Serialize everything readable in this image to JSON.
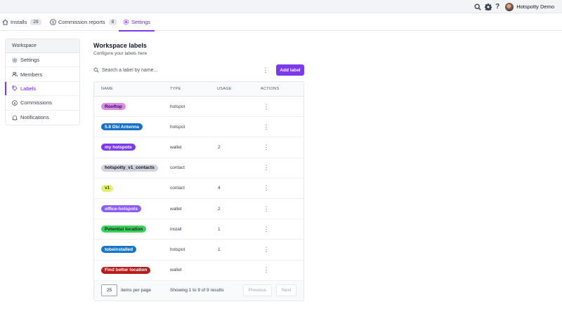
{
  "topbar": {
    "user_name": "Hotspotty Demo",
    "icons": [
      "search-icon",
      "gear-icon",
      "help-icon",
      "avatar"
    ],
    "help_glyph": "?"
  },
  "tabs": [
    {
      "label": "Installs",
      "count": "29",
      "icon": "home-icon"
    },
    {
      "label": "Commission reports",
      "count": "8",
      "icon": "dollar-circle-icon"
    },
    {
      "label": "Settings",
      "icon": "gear-icon",
      "active": true
    }
  ],
  "sidebar": {
    "heading": "Workspace",
    "items": [
      {
        "label": "Settings",
        "icon": "gear-icon"
      },
      {
        "label": "Members",
        "icon": "users-icon"
      },
      {
        "label": "Labels",
        "icon": "tag-icon",
        "active": true
      },
      {
        "label": "Commissions",
        "icon": "dollar-circle-icon"
      },
      {
        "label": "Notifications",
        "icon": "bell-icon"
      }
    ]
  },
  "main": {
    "title": "Workspace labels",
    "subtitle": "Configure your labels here",
    "search_placeholder": "Search a label by name...",
    "add_button": "Add label",
    "more_glyph": "⋮"
  },
  "table": {
    "columns": [
      "NAME",
      "TYPE",
      "USAGE",
      "ACTIONS"
    ],
    "rows": [
      {
        "name": "Rooftop",
        "type": "hotspot",
        "usage": "",
        "bg": "#d98ce0",
        "fg": "#3b0764"
      },
      {
        "name": "5.8 Dbi Antenna",
        "type": "hotspot",
        "usage": "",
        "bg": "#1d6fc4",
        "fg": "#ffffff"
      },
      {
        "name": "my hotspots",
        "type": "wallet",
        "usage": "2",
        "bg": "#7c3aed",
        "fg": "#ffffff"
      },
      {
        "name": "hotspotty_v1_contacts",
        "type": "contact",
        "usage": "",
        "bg": "#d1d5db",
        "fg": "#111827"
      },
      {
        "name": "v1",
        "type": "contact",
        "usage": "4",
        "bg": "#e7ef73",
        "fg": "#3f3f00"
      },
      {
        "name": "office-hotspots",
        "type": "wallet",
        "usage": "2",
        "bg": "#8b5cf6",
        "fg": "#ffffff"
      },
      {
        "name": "Potential location",
        "type": "install",
        "usage": "1",
        "bg": "#3ccf5a",
        "fg": "#052e16"
      },
      {
        "name": "tobeinstalled",
        "type": "hotspot",
        "usage": "1",
        "bg": "#1677c9",
        "fg": "#ffffff"
      },
      {
        "name": "Find better location",
        "type": "wallet",
        "usage": "",
        "bg": "#b91c1c",
        "fg": "#ffffff"
      }
    ]
  },
  "pagination": {
    "per_page": "25",
    "per_page_label": "items per page",
    "showing": "Showing 1 to 9 of 9 results",
    "previous": "Previous",
    "next": "Next"
  },
  "colors": {
    "accent": "#7c3aed",
    "accent_text": "#6d28d9"
  }
}
